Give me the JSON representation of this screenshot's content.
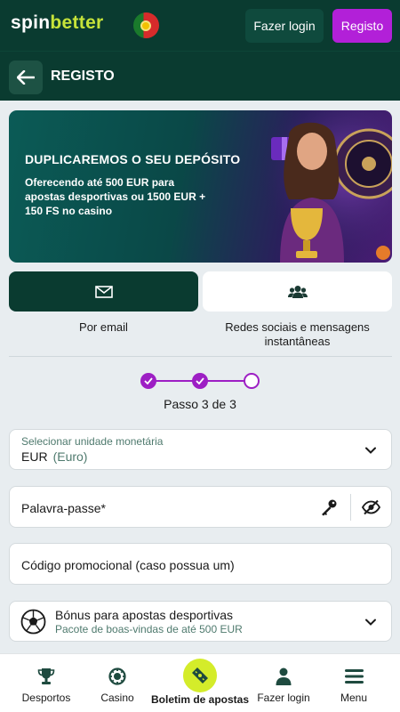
{
  "header": {
    "logo_part1": "spin",
    "logo_part2": "better",
    "login_label": "Fazer login",
    "register_label": "Registo"
  },
  "subheader": {
    "title": "REGISTO"
  },
  "banner": {
    "title": "DUPLICAREMOS O SEU DEPÓSITO",
    "text": "Oferecendo até 500 EUR para apostas desportivas ou 1500 EUR + 150 FS no casino"
  },
  "methods": [
    {
      "label": "Por email",
      "icon": "envelope-icon",
      "selected": true
    },
    {
      "label": "Redes sociais e mensagens instantâneas",
      "icon": "users-icon",
      "selected": false
    }
  ],
  "stepper": {
    "total": 3,
    "current": 3,
    "text": "Passo 3 de 3"
  },
  "form": {
    "currency": {
      "label": "Selecionar unidade monetária",
      "value": "EUR",
      "value_desc": "(Euro)"
    },
    "password": {
      "placeholder": "Palavra-passe*"
    },
    "promo": {
      "placeholder": "Código promocional (caso possua um)"
    },
    "bonus": {
      "title": "Bónus para apostas desportivas",
      "subtitle": "Pacote de boas-vindas de até 500 EUR"
    }
  },
  "bottom_nav": [
    {
      "label": "Desportos",
      "icon": "trophy-icon"
    },
    {
      "label": "Casino",
      "icon": "casino-chip-icon"
    },
    {
      "label": "Boletim de apostas",
      "icon": "ticket-icon"
    },
    {
      "label": "Fazer login",
      "icon": "user-icon"
    },
    {
      "label": "Menu",
      "icon": "menu-icon"
    }
  ],
  "colors": {
    "header_bg": "#0a3b30",
    "accent_purple": "#b220d8",
    "accent_lime": "#d4ec2a",
    "page_bg": "#e8edf0"
  }
}
